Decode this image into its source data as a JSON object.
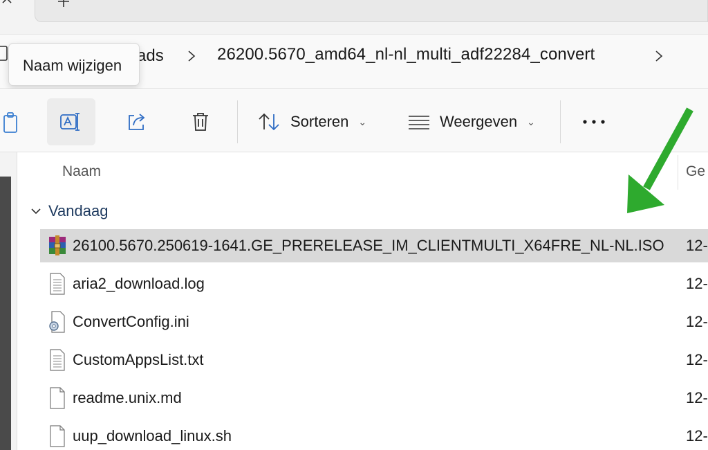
{
  "tooltip": {
    "text": "Naam wijzigen"
  },
  "breadcrumb": {
    "previous_partial": "ads",
    "current": "26200.5670_amd64_nl-nl_multi_adf22284_convert"
  },
  "toolbar": {
    "sort_label": "Sorteren",
    "view_label": "Weergeven"
  },
  "columns": {
    "name": "Naam",
    "date_partial": "Ge"
  },
  "group": {
    "label": "Vandaag"
  },
  "files": [
    {
      "name": "26100.5670.250619-1641.GE_PRERELEASE_IM_CLIENTMULTI_X64FRE_NL-NL.ISO",
      "date": "12-",
      "icon": "winrar-archive-icon"
    },
    {
      "name": "aria2_download.log",
      "date": "12-",
      "icon": "text-file-icon"
    },
    {
      "name": "ConvertConfig.ini",
      "date": "12-",
      "icon": "config-file-icon"
    },
    {
      "name": "CustomAppsList.txt",
      "date": "12-",
      "icon": "text-file-icon"
    },
    {
      "name": "readme.unix.md",
      "date": "12-",
      "icon": "blank-file-icon"
    },
    {
      "name": "uup_download_linux.sh",
      "date": "12-",
      "icon": "blank-file-icon"
    }
  ],
  "colors": {
    "selected_row": "#d9d9d9",
    "annotation_arrow": "#2eaa2e",
    "group_header": "#1e3a5f"
  }
}
